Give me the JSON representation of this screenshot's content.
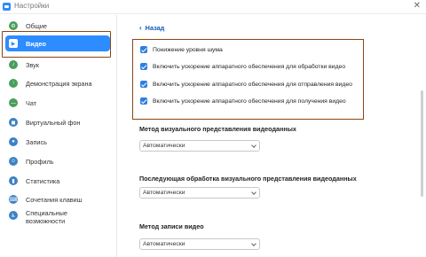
{
  "window": {
    "title": "Настройки"
  },
  "sidebar": {
    "items": [
      {
        "label": "Общие",
        "icon": "gear-icon",
        "color": "#4a9e5c"
      },
      {
        "label": "Видео",
        "icon": "video-camera-icon",
        "color": "#ffffff",
        "active": true
      },
      {
        "label": "Звук",
        "icon": "headphones-icon",
        "color": "#4a9e5c"
      },
      {
        "label": "Демонстрация экрана",
        "icon": "screen-share-icon",
        "color": "#4a9e5c"
      },
      {
        "label": "Чат",
        "icon": "chat-icon",
        "color": "#4a9e5c"
      },
      {
        "label": "Виртуальный фон",
        "icon": "person-background-icon",
        "color": "#3b82c4"
      },
      {
        "label": "Запись",
        "icon": "record-icon",
        "color": "#3b82c4"
      },
      {
        "label": "Профиль",
        "icon": "profile-icon",
        "color": "#3b82c4"
      },
      {
        "label": "Статистика",
        "icon": "statistics-icon",
        "color": "#3b82c4"
      },
      {
        "label": "Сочетания клавиш",
        "icon": "keyboard-icon",
        "color": "#3b82c4"
      },
      {
        "label": "Специальные возможности",
        "icon": "accessibility-icon",
        "color": "#3b82c4"
      }
    ]
  },
  "main": {
    "back_label": "Назад",
    "checkboxes": [
      {
        "label": "Понижение уровня шума",
        "checked": true
      },
      {
        "label": "Включить ускорение аппаратного обеспечения для обработки видео",
        "checked": true
      },
      {
        "label": "Включить ускорение аппаратного обеспечения для отправления видео",
        "checked": true
      },
      {
        "label": "Включить ускорение аппаратного обеспечения для получения видео",
        "checked": true
      }
    ],
    "sections": [
      {
        "label": "Метод визуального представления видеоданных",
        "value": "Автоматически"
      },
      {
        "label": "Последующая обработка визуального представления видеоданных",
        "value": "Автоматически"
      },
      {
        "label": "Метод записи видео",
        "value": "Автоматически"
      }
    ]
  },
  "colors": {
    "accent": "#2d8cff",
    "highlight_border": "#8b4513",
    "checkbox": "#2d7ee0",
    "link": "#0e5cb8"
  }
}
